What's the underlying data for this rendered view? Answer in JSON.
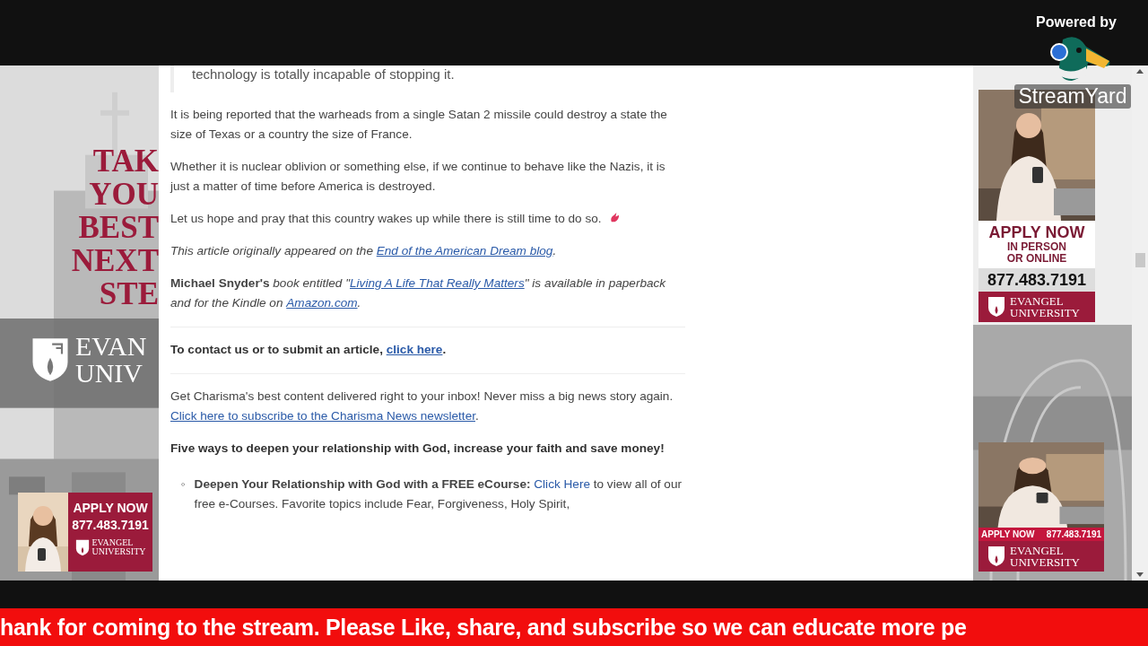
{
  "stream_overlay": {
    "powered_by": "Powered by",
    "brand": "StreamYard"
  },
  "left_ad": {
    "headline": [
      "TAK",
      "YOU",
      "BEST",
      "NEXT",
      "STE"
    ],
    "logo_lines": [
      "EVAN",
      "UNIV"
    ],
    "banner": {
      "cta": "APPLY NOW",
      "phone": "877.483.7191",
      "logo_lines": [
        "EVANGEL",
        "UNIVERSITY"
      ]
    }
  },
  "article": {
    "quote": "technology is totally incapable of stopping it.",
    "blocks": [
      {
        "kind": "paragraph",
        "segments": [
          {
            "kind": "text",
            "text": "It is being reported that the warheads from a single Satan 2 missile could destroy a state the size of Texas or a country the size of France."
          }
        ]
      },
      {
        "kind": "paragraph",
        "segments": [
          {
            "kind": "text",
            "text": "Whether it is nuclear oblivion or something else, if we continue to behave like the Nazis, it is just a matter of time before America is destroyed."
          }
        ]
      },
      {
        "kind": "paragraph",
        "emoji": true,
        "segments": [
          {
            "kind": "text",
            "text": "Let us hope and pray that this country wakes up while there is still time to do so."
          }
        ]
      },
      {
        "kind": "note",
        "segments": [
          {
            "kind": "text",
            "text": "This article originally appeared on the "
          },
          {
            "kind": "link",
            "text": "End of the American Dream blog"
          },
          {
            "kind": "text",
            "text": "."
          }
        ]
      },
      {
        "kind": "paragraph",
        "segments": [
          {
            "kind": "text",
            "text": "**Michael Snyder's** *book entitled \"*"
          },
          {
            "kind": "link",
            "text": "*Living A Life That Really Matters*"
          },
          {
            "kind": "text",
            "text": "*\" is available in paperback and for the Kindle on* "
          },
          {
            "kind": "link",
            "text": "*Amazon.com*"
          },
          {
            "kind": "text",
            "text": "*.*"
          }
        ]
      },
      {
        "kind": "divider"
      },
      {
        "kind": "emphasis",
        "segments": [
          {
            "kind": "text",
            "text": "To contact us or to submit an article, "
          },
          {
            "kind": "link",
            "text": "click here"
          },
          {
            "kind": "text",
            "text": "."
          }
        ]
      },
      {
        "kind": "divider"
      },
      {
        "kind": "paragraph",
        "segments": [
          {
            "kind": "text",
            "text": "Get Charisma's best content delivered right to your inbox! Never miss a big news story again. "
          },
          {
            "kind": "link",
            "text": "Click here to subscribe to the Charisma News newsletter"
          },
          {
            "kind": "text",
            "text": "."
          }
        ]
      },
      {
        "kind": "emphasis",
        "segments": [
          {
            "kind": "text",
            "text": "Five ways to deepen your relationship with God, increase your faith and save money!"
          }
        ]
      },
      {
        "kind": "bullet",
        "marker": "◦",
        "segments": [
          {
            "kind": "text",
            "text": "**Deepen Your Relationship with God with a FREE eCourse:** "
          },
          {
            "kind": "plainlink",
            "text": "Click Here"
          },
          {
            "kind": "text",
            "text": " to view all of our free e-Courses. Favorite topics include Fear, Forgiveness, Holy Spirit,"
          }
        ]
      }
    ]
  },
  "right_ads": [
    {
      "kind": "tall",
      "cta": "APPLY NOW",
      "sub": [
        "IN PERSON",
        "OR ONLINE"
      ],
      "phone": "877.483.7191",
      "logo_lines": [
        "EVANGEL",
        "UNIVERSITY"
      ]
    },
    {
      "kind": "short",
      "cta": "APPLY NOW",
      "phone": "877.483.7191",
      "logo_lines": [
        "EVANGEL",
        "UNIVERSITY"
      ]
    }
  ],
  "ticker": "hank for coming to the stream. Please Like, share, and subscribe so we can educate more pe"
}
